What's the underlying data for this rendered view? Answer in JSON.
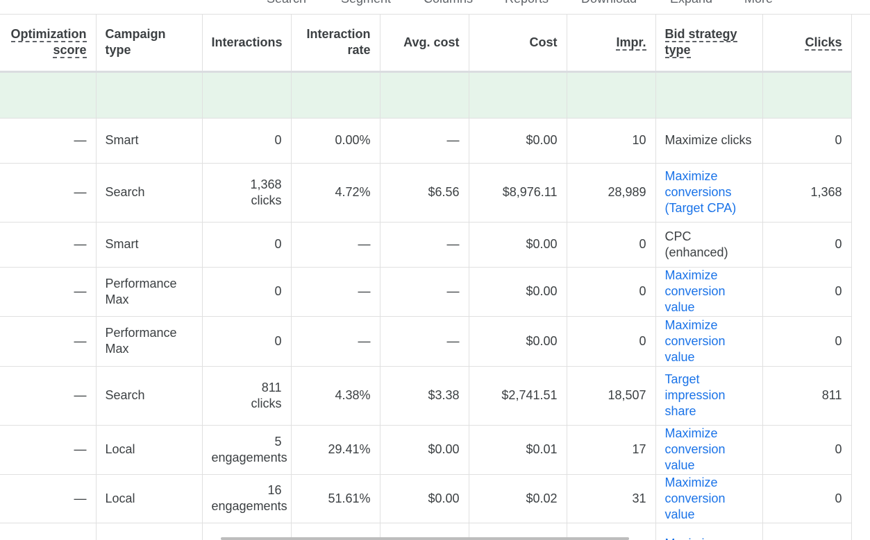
{
  "toolbar": {
    "items": [
      "Search",
      "Segment",
      "Columns",
      "Reports",
      "Download",
      "Expand",
      "More"
    ]
  },
  "columns": {
    "optimization_score": [
      "Optimization",
      "score"
    ],
    "campaign_type": [
      "Campaign",
      "type"
    ],
    "interactions": "Interactions",
    "interaction_rate": [
      "Interaction",
      "rate"
    ],
    "avg_cost": "Avg. cost",
    "cost": "Cost",
    "impr": "Impr.",
    "bid_strategy_type": [
      "Bid strategy",
      "type"
    ],
    "clicks": "Clicks"
  },
  "rows": [
    {
      "opt": "—",
      "type": "Smart",
      "interactions": [
        "0"
      ],
      "rate": "0.00%",
      "avg": "—",
      "cost": "$0.00",
      "impr": "10",
      "bid": [
        "Maximize clicks"
      ],
      "bid_link": false,
      "clicks": "0"
    },
    {
      "opt": "—",
      "type": "Search",
      "interactions": [
        "1,368",
        "clicks"
      ],
      "rate": "4.72%",
      "avg": "$6.56",
      "cost": "$8,976.11",
      "impr": "28,989",
      "bid": [
        "Maximize",
        "conversions",
        "(Target CPA)"
      ],
      "bid_link": true,
      "clicks": "1,368"
    },
    {
      "opt": "—",
      "type": "Smart",
      "interactions": [
        "0"
      ],
      "rate": "—",
      "avg": "—",
      "cost": "$0.00",
      "impr": "0",
      "bid": [
        "CPC (enhanced)"
      ],
      "bid_link": false,
      "clicks": "0"
    },
    {
      "opt": "—",
      "type": "Performance Max",
      "interactions": [
        "0"
      ],
      "rate": "—",
      "avg": "—",
      "cost": "$0.00",
      "impr": "0",
      "bid": [
        "Maximize",
        "conversion",
        "value"
      ],
      "bid_link": true,
      "clicks": "0"
    },
    {
      "opt": "—",
      "type": "Performance Max",
      "interactions": [
        "0"
      ],
      "rate": "—",
      "avg": "—",
      "cost": "$0.00",
      "impr": "0",
      "bid": [
        "Maximize",
        "conversion",
        "value"
      ],
      "bid_link": true,
      "clicks": "0"
    },
    {
      "opt": "—",
      "type": "Search",
      "interactions": [
        "811",
        "clicks"
      ],
      "rate": "4.38%",
      "avg": "$3.38",
      "cost": "$2,741.51",
      "impr": "18,507",
      "bid": [
        "Target",
        "impression",
        "share"
      ],
      "bid_link": true,
      "clicks": "811"
    },
    {
      "opt": "—",
      "type": "Local",
      "interactions": [
        "5",
        "engagements"
      ],
      "rate": "29.41%",
      "avg": "$0.00",
      "cost": "$0.01",
      "impr": "17",
      "bid": [
        "Maximize",
        "conversion",
        "value"
      ],
      "bid_link": true,
      "clicks": "0"
    },
    {
      "opt": "—",
      "type": "Local",
      "interactions": [
        "16",
        "engagements"
      ],
      "rate": "51.61%",
      "avg": "$0.00",
      "cost": "$0.02",
      "impr": "31",
      "bid": [
        "Maximize",
        "conversion",
        "value"
      ],
      "bid_link": true,
      "clicks": "0"
    },
    {
      "opt": "",
      "type": "",
      "interactions": [
        ""
      ],
      "rate": "",
      "avg": "",
      "cost": "",
      "impr": "",
      "bid": [
        "Maximize"
      ],
      "bid_link": true,
      "clicks": ""
    }
  ]
}
